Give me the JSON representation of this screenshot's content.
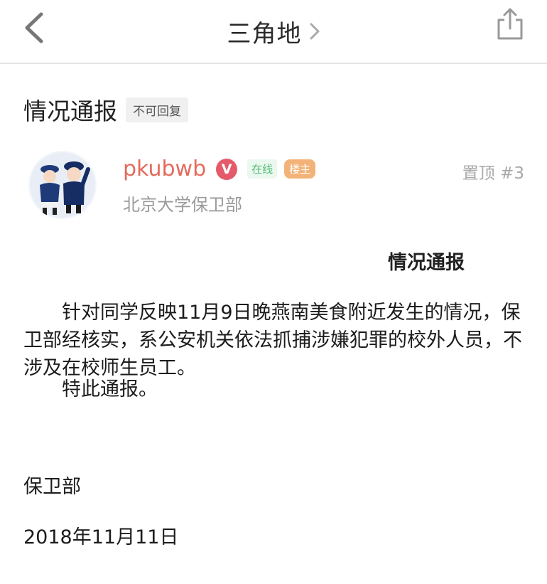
{
  "nav": {
    "title": "三角地",
    "back_icon": "back-arrow-icon",
    "chevron_icon": "chevron-right-icon",
    "share_icon": "share-icon"
  },
  "thread": {
    "title": "情况通报",
    "badge": "不可回复"
  },
  "post": {
    "author": "pkubwb",
    "verified_badge": "V",
    "online_badge": "在线",
    "op_badge": "楼主",
    "org": "北京大学保卫部",
    "pin_label": "置顶 #3",
    "avatar_icon": "police-avatar-icon"
  },
  "content": {
    "title": "情况通报",
    "paragraph1": "针对同学反映11月9日晚燕南美食附近发生的情况，保卫部经核实，系公安机关依法抓捕涉嫌犯罪的校外人员，不涉及在校师生员工。",
    "paragraph2": "特此通报。",
    "signature": "保卫部",
    "date": "2018年11月11日"
  },
  "colors": {
    "author": "#e46a5c",
    "verified": "#e45a6a",
    "online": "#55bb77",
    "op": "#f3b378"
  }
}
